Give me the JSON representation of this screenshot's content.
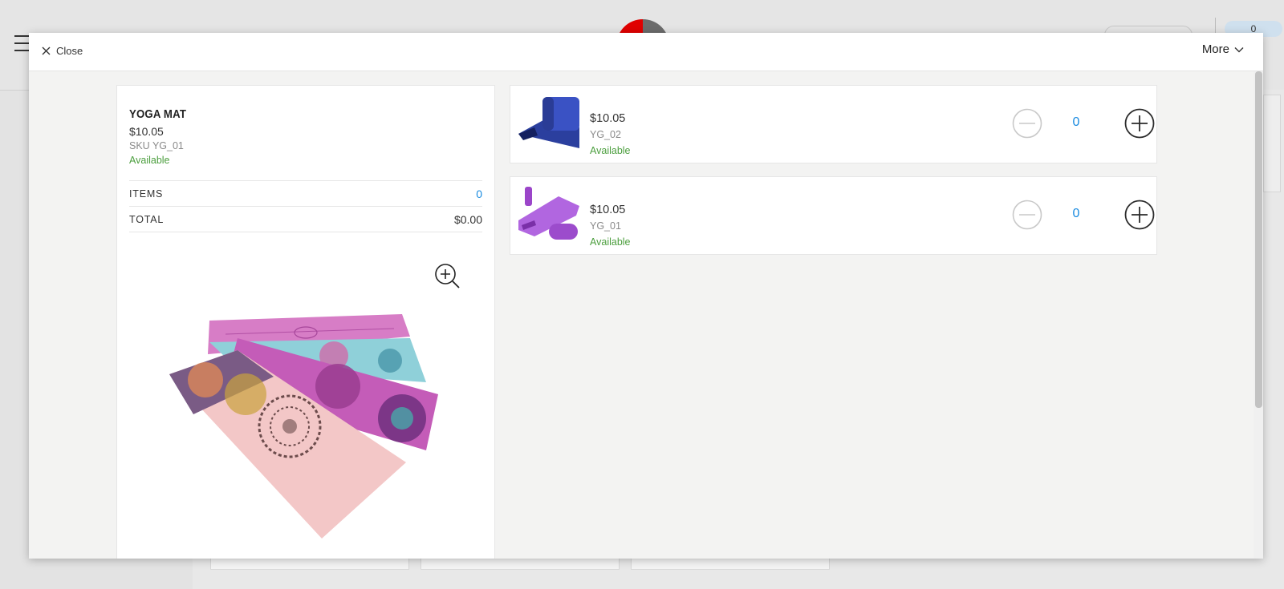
{
  "background": {
    "cart_count": "0"
  },
  "modal": {
    "close_label": "Close",
    "more_label": "More"
  },
  "product": {
    "title": "YOGA MAT",
    "price": "$10.05",
    "sku": "SKU YG_01",
    "availability": "Available",
    "summary": {
      "items_label": "ITEMS",
      "items_value": "0",
      "total_label": "TOTAL",
      "total_value": "$0.00"
    }
  },
  "variants": [
    {
      "price": "$10.05",
      "sku": "YG_02",
      "availability": "Available",
      "quantity": "0",
      "thumb_color": "#2b3f9e"
    },
    {
      "price": "$10.05",
      "sku": "YG_01",
      "availability": "Available",
      "quantity": "0",
      "thumb_color": "#a855d6"
    }
  ],
  "colors": {
    "available_green": "#4b9e3d",
    "qty_blue": "#1a8be0"
  }
}
